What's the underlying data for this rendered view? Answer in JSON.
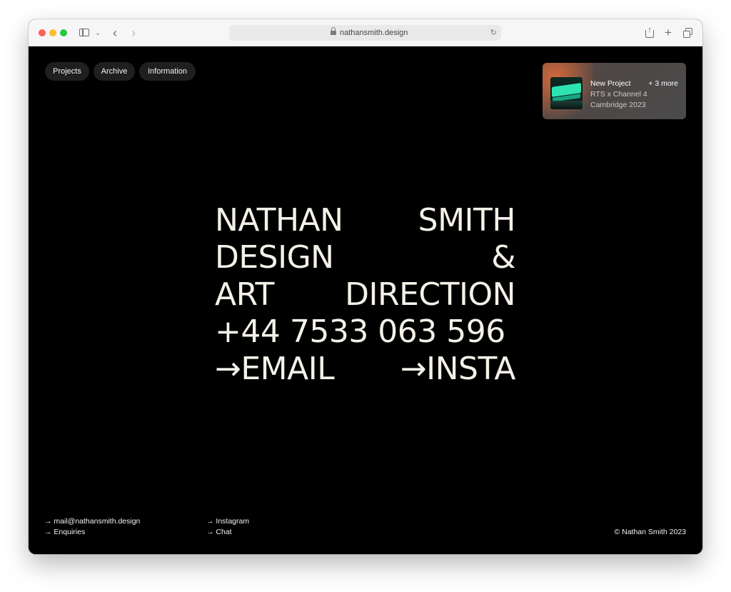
{
  "browser": {
    "url": "nathansmith.design",
    "icons": {
      "sidebar": "sidebar-icon",
      "back": "chevron-left-icon",
      "forward": "chevron-right-icon",
      "share": "share-icon",
      "new_tab": "plus-icon",
      "tabs": "tab-overview-icon"
    }
  },
  "nav": {
    "items": [
      {
        "label": "Projects"
      },
      {
        "label": "Archive"
      },
      {
        "label": "Information"
      }
    ]
  },
  "project_card": {
    "title": "New Project",
    "more": "+ 3 more",
    "line1": "RTS x Channel 4",
    "line2": "Cambridge 2023"
  },
  "hero": {
    "row1": {
      "a": "NATHAN",
      "b": "SMITH"
    },
    "row2": {
      "a": "DESIGN",
      "b": "&"
    },
    "row3": {
      "a": "ART",
      "b": "DIRECTION"
    },
    "row4": {
      "a": "+44 7533 063 596"
    },
    "row5": {
      "a": "→EMAIL",
      "b": "→INSTA"
    }
  },
  "footer": {
    "col1": [
      "→ mail@nathansmith.design",
      "→ Enquiries"
    ],
    "col2": [
      "→ Instagram",
      "→ Chat"
    ],
    "copyright": "© Nathan Smith 2023"
  },
  "colors": {
    "background": "#000000",
    "hero_text": "#f4f1e8",
    "pill_bg": "#1f1f1f"
  }
}
